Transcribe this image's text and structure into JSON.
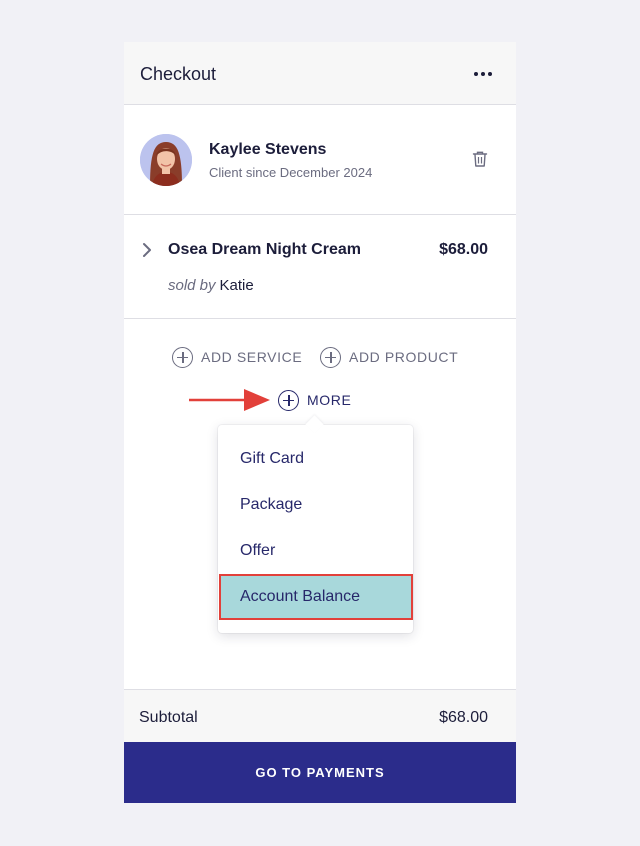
{
  "header": {
    "title": "Checkout",
    "menu_icon": "more-dots-icon"
  },
  "client": {
    "name": "Kaylee Stevens",
    "since": "Client since December 2024",
    "delete_icon": "trash-icon"
  },
  "item": {
    "name": "Osea Dream Night Cream",
    "price": "$68.00",
    "sold_by_label": "sold by",
    "sold_by": "Katie"
  },
  "actions": {
    "add_service": "ADD SERVICE",
    "add_product": "ADD PRODUCT",
    "more": "MORE"
  },
  "more_menu": {
    "items": [
      {
        "label": "Gift Card"
      },
      {
        "label": "Package"
      },
      {
        "label": "Offer"
      },
      {
        "label": "Account Balance",
        "highlighted": true
      }
    ]
  },
  "summary": {
    "subtotal_label": "Subtotal",
    "subtotal_value": "$68.00"
  },
  "cta": {
    "label": "GO TO PAYMENTS"
  },
  "colors": {
    "primary": "#2b2c8b",
    "highlight": "#a8d8db",
    "annotation": "#e2403a"
  }
}
